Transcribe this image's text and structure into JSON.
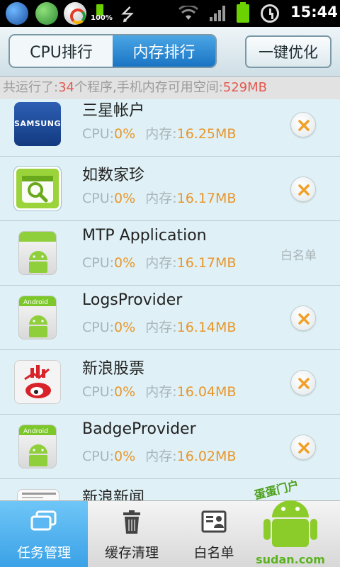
{
  "status_bar": {
    "battery_percent_label": "100%",
    "time": "15:44"
  },
  "top_bar": {
    "tabs": [
      {
        "label": "CPU排行",
        "active": false
      },
      {
        "label": "内存排行",
        "active": true
      }
    ],
    "optimize_button": "一键优化"
  },
  "summary": {
    "prefix": "共运行了:",
    "count": "34",
    "mid": "个程序,手机内存可用空间:",
    "free_memory": "529MB"
  },
  "list": {
    "cpu_label": "CPU:",
    "mem_label": "内存:",
    "whitelist_label": "白名单",
    "items": [
      {
        "name": "三星帐户",
        "cpu": "0%",
        "mem": "16.25MB",
        "icon": "samsung-account-icon",
        "icon_text": "SAMSUNG",
        "whitelisted": false
      },
      {
        "name": "如数家珍",
        "cpu": "0%",
        "mem": "16.17MB",
        "icon": "rushujiazhen-app-icon",
        "whitelisted": false
      },
      {
        "name": "MTP Application",
        "cpu": "0%",
        "mem": "16.17MB",
        "icon": "android-app-icon",
        "whitelisted": true
      },
      {
        "name": "LogsProvider",
        "cpu": "0%",
        "mem": "16.14MB",
        "icon": "android-app-icon",
        "icon_text": "Android",
        "whitelisted": false
      },
      {
        "name": "新浪股票",
        "cpu": "0%",
        "mem": "16.04MB",
        "icon": "sina-stock-icon",
        "whitelisted": false
      },
      {
        "name": "BadgeProvider",
        "cpu": "0%",
        "mem": "16.02MB",
        "icon": "android-app-icon",
        "icon_text": "Android",
        "whitelisted": false
      },
      {
        "name": "新浪新闻",
        "cpu": "",
        "mem": "",
        "icon": "sina-news-icon",
        "whitelisted": false
      }
    ]
  },
  "bottom_nav": {
    "items": [
      {
        "label": "任务管理",
        "icon": "task-manager-icon",
        "active": true
      },
      {
        "label": "缓存清理",
        "icon": "trash-icon",
        "active": false
      },
      {
        "label": "白名单",
        "icon": "whitelist-card-icon",
        "active": false
      }
    ]
  },
  "watermark": {
    "top_text": "蛋蛋门户",
    "site": "sudan.com"
  },
  "colors": {
    "accent_blue": "#1a74c4",
    "value_orange": "#e8962a",
    "highlight_red": "#e4584f",
    "list_bg": "#dff1f6"
  }
}
